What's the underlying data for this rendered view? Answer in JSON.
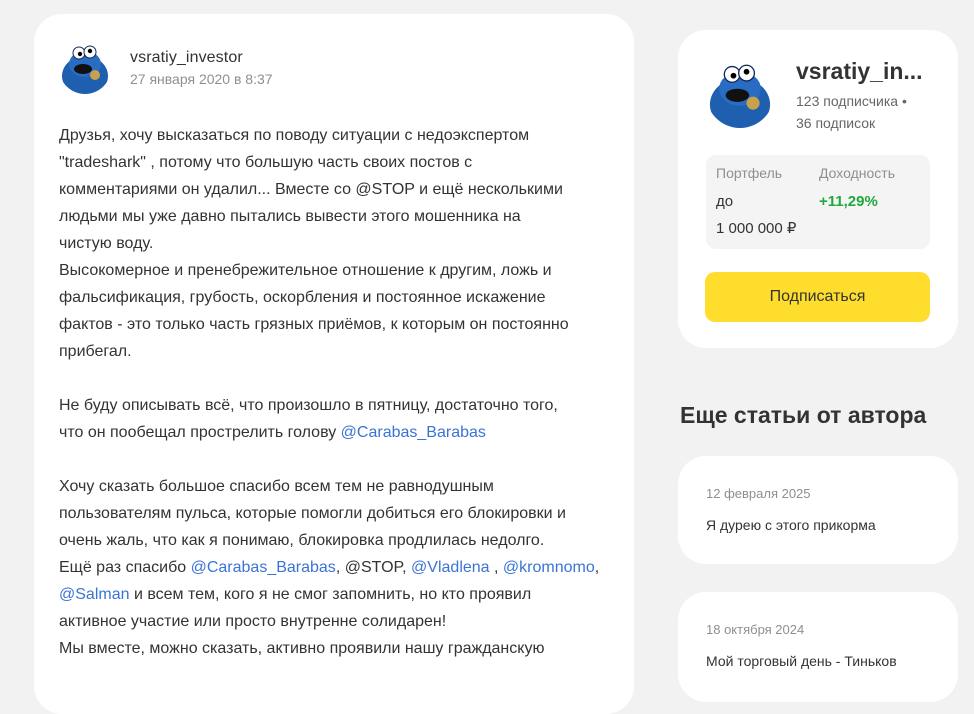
{
  "post": {
    "author": "vsratiy_investor",
    "date": "27 января 2020 в 8:37",
    "lines": {
      "l1": "Друзья, хочу высказаться по поводу ситуации с недоэкспертом",
      "l2": "\"tradeshark\" , потому что большую часть своих постов с",
      "l3": "комментариями он удалил... Вместе со @STOP и ещё несколькими",
      "l4": "людьми мы уже давно пытались вывести этого мошенника на",
      "l5": "чистую воду.",
      "l6": "Высокомерное и пренебрежительное отношение к другим, ложь и",
      "l7": "фальсификация, грубость, оскорбления и постоянное искажение",
      "l8": "фактов - это только часть грязных приёмов, к которым он постоянно",
      "l9": "прибегал.",
      "l10": "Не буду описывать всё, что произошло в пятницу, достаточно того,",
      "l11_text": "что он пообещал прострелить голову ",
      "l11_mention": "@Carabas_Barabas",
      "l12": "Хочу сказать большое спасибо всем тем не равнодушным",
      "l13": "пользователям пульса, которые помогли добиться его блокировки и",
      "l14": "очень жаль, что как я понимаю, блокировка продлилась недолго.",
      "l15_a": "Ещё раз спасибо ",
      "l15_m1": "@Carabas_Barabas",
      "l15_b": ", @STOP, ",
      "l15_m2": "@Vladlena ",
      "l15_c": ", ",
      "l15_m3": "@kromnomo",
      "l15_d": ",",
      "l16_m": "@Salman",
      "l16_text": " и всем тем, кого я не смог запомнить, но кто проявил",
      "l17": "активное участие или просто внутренне солидарен!",
      "l18": "Мы вместе, можно сказать, активно проявили нашу гражданскую"
    }
  },
  "profile": {
    "name": "vsratiy_in...",
    "followers_line1": "123 подписчика •",
    "followers_line2": "36 подписок",
    "portfolio_label": "Портфель",
    "portfolio_value_line1": "до",
    "portfolio_value_line2": "1 000 000 ₽",
    "yield_label": "Доходность",
    "yield_value": "+11,29%",
    "subscribe_label": "Подписаться"
  },
  "more_articles": {
    "title": "Еще статьи от автора",
    "items": [
      {
        "date": "12 февраля 2025",
        "title": "Я дурею с этого прикорма"
      },
      {
        "date": "18 октября 2024",
        "title": "Мой торговый день - Тиньков"
      }
    ]
  },
  "colors": {
    "accent_yellow": "#ffdd2d",
    "positive_green": "#1fa83e",
    "mention_blue": "#3b73d6",
    "page_bg": "#f2f2f2"
  }
}
